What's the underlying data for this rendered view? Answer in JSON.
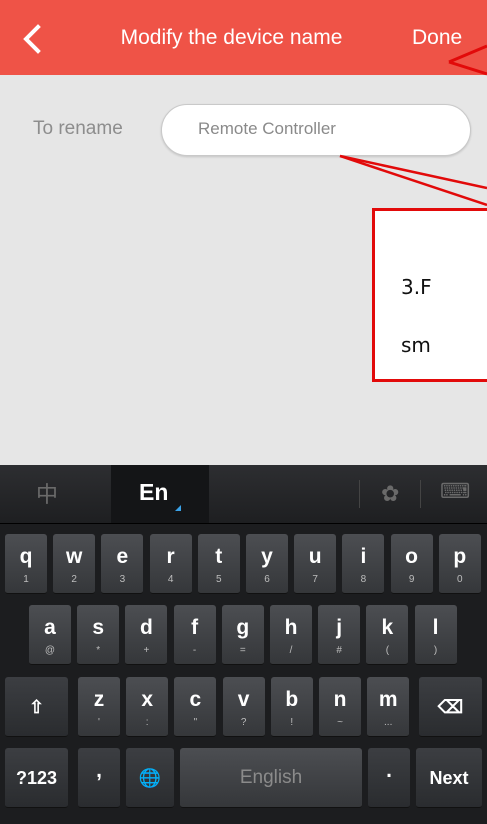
{
  "header": {
    "back_icon": "back-arrow-icon",
    "title": "Modify the device name",
    "done_label": "Done",
    "background": "#ef5347"
  },
  "form": {
    "label": "To rename",
    "input_value": "Remote Controller"
  },
  "callout": {
    "line1": "3.F",
    "line2": "sm",
    "border_color": "#e20a0a"
  },
  "keyboard": {
    "tab_chinese": "中",
    "tab_english": "En",
    "settings_icon": "gear-icon",
    "hide_keyboard_icon": "keyboard-icon",
    "row1": [
      {
        "c": "q",
        "s": "1"
      },
      {
        "c": "w",
        "s": "2"
      },
      {
        "c": "e",
        "s": "3"
      },
      {
        "c": "r",
        "s": "4"
      },
      {
        "c": "t",
        "s": "5"
      },
      {
        "c": "y",
        "s": "6"
      },
      {
        "c": "u",
        "s": "7"
      },
      {
        "c": "i",
        "s": "8"
      },
      {
        "c": "o",
        "s": "9"
      },
      {
        "c": "p",
        "s": "0"
      }
    ],
    "row2": [
      {
        "c": "a",
        "s": "@"
      },
      {
        "c": "s",
        "s": "*"
      },
      {
        "c": "d",
        "s": "+"
      },
      {
        "c": "f",
        "s": "-"
      },
      {
        "c": "g",
        "s": "="
      },
      {
        "c": "h",
        "s": "/"
      },
      {
        "c": "j",
        "s": "#"
      },
      {
        "c": "k",
        "s": "("
      },
      {
        "c": "l",
        "s": ")"
      }
    ],
    "row3": [
      {
        "c": "z",
        "s": "'"
      },
      {
        "c": "x",
        "s": ":"
      },
      {
        "c": "c",
        "s": "\""
      },
      {
        "c": "v",
        "s": "?"
      },
      {
        "c": "b",
        "s": "!"
      },
      {
        "c": "n",
        "s": "~"
      },
      {
        "c": "m",
        "s": "..."
      }
    ],
    "shift_icon": "shift-arrow-icon",
    "backspace_icon": "backspace-icon",
    "symbols_label": "?123",
    "comma_label": ",",
    "globe_icon": "globe-icon",
    "space_label": "English",
    "period_label": ".",
    "next_label": "Next"
  }
}
